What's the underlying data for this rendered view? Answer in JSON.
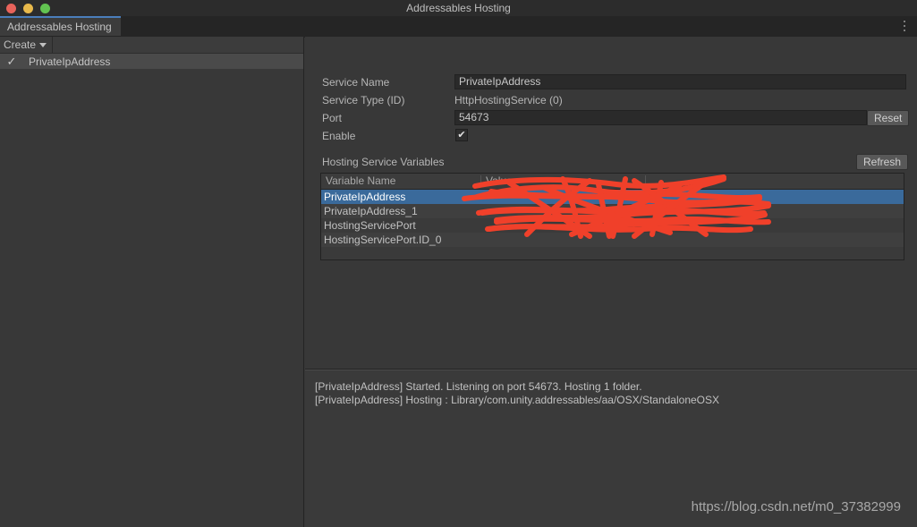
{
  "window": {
    "title": "Addressables Hosting",
    "traffic_lights": [
      "close-button",
      "minimize-button",
      "zoom-button"
    ]
  },
  "tab": {
    "label": "Addressables Hosting",
    "overflow_menu_icon": "kebab-menu-icon"
  },
  "sidebar": {
    "create_button": "Create",
    "create_caret_icon": "chevron-down-icon",
    "services": [
      {
        "enabled_icon": "checkmark-icon",
        "label": "PrivateIpAddress",
        "selected": true
      }
    ]
  },
  "inspector": {
    "fields": [
      {
        "label": "Service Name",
        "type": "text",
        "value": "PrivateIpAddress"
      },
      {
        "label": "Service Type (ID)",
        "type": "static",
        "value": "HttpHostingService (0)"
      },
      {
        "label": "Port",
        "type": "text",
        "value": "54673"
      },
      {
        "label": "Enable",
        "type": "checkbox",
        "value": "✔"
      }
    ],
    "reset_button": "Reset",
    "refresh_button": "Refresh",
    "variables_section_title": "Hosting Service Variables",
    "table": {
      "columns": [
        "Variable Name",
        "Value"
      ],
      "rows": [
        {
          "name": "PrivateIpAddress",
          "value": "",
          "selected": true
        },
        {
          "name": "PrivateIpAddress_1",
          "value": "",
          "selected": false
        },
        {
          "name": "HostingServicePort",
          "value": "",
          "selected": false
        },
        {
          "name": "HostingServicePort.ID_0",
          "value": "",
          "selected": false
        }
      ],
      "redaction": "red-scribble-overlay"
    }
  },
  "log": {
    "lines": [
      "[PrivateIpAddress] Started. Listening on port 54673. Hosting 1 folder.",
      "[PrivateIpAddress] Hosting : Library/com.unity.addressables/aa/OSX/StandaloneOSX"
    ]
  },
  "watermark": {
    "text": "https://blog.csdn.net/m0_37382999"
  },
  "colors": {
    "background": "#383838",
    "panel": "#3a3a3a",
    "titlebar": "#2c2c2c",
    "tab_accent": "#4a7ebb",
    "selection": "#3a6a9b",
    "text": "#b4b4b4",
    "redaction": "#f0402a"
  }
}
